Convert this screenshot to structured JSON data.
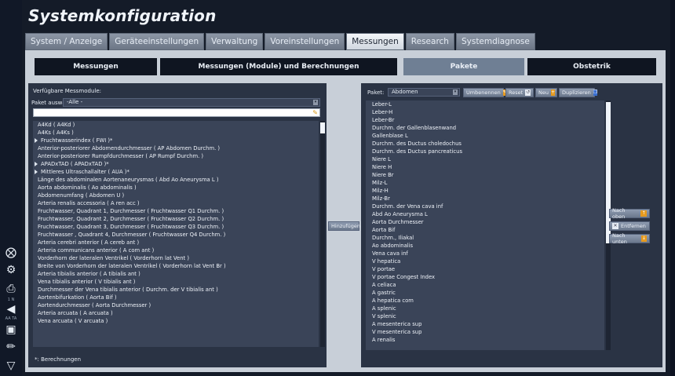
{
  "title": "Systemkonfiguration",
  "tabs": [
    {
      "label": "System / Anzeige"
    },
    {
      "label": "Geräteeinstellungen"
    },
    {
      "label": "Verwaltung"
    },
    {
      "label": "Voreinstellungen"
    },
    {
      "label": "Messungen"
    },
    {
      "label": "Research"
    },
    {
      "label": "Systemdiagnose"
    }
  ],
  "active_tab": "Messungen",
  "subtabs": [
    {
      "label": "Messungen"
    },
    {
      "label": "Messungen (Module) und Berechnungen"
    },
    {
      "label": "Pakete"
    },
    {
      "label": "Obstetrik"
    }
  ],
  "active_subtab": "Pakete",
  "left": {
    "heading": "Verfügbare Messmodule:",
    "paket_label": "Paket auswählen",
    "paket_value": "-Alle -",
    "search_value": "",
    "footer": "*: Berechnungen",
    "items": [
      {
        "text": "A4Kd ( A4Kd )",
        "expand": false
      },
      {
        "text": "A4Ks ( A4Ks )",
        "expand": false
      },
      {
        "text": "Fruchtwasserindex ( FWI )*",
        "expand": true
      },
      {
        "text": "Anterior-posteriorer Abdomendurchmesser ( AP Abdomen Durchm. )",
        "expand": false
      },
      {
        "text": "Anterior-posteriorer Rumpfdurchmesser ( AP Rumpf Durchm. )",
        "expand": false
      },
      {
        "text": "APADxTAD ( APADxTAD )*",
        "expand": true
      },
      {
        "text": "Mittleres Ultraschallalter ( AUA )*",
        "expand": true
      },
      {
        "text": "Länge des abdominalen Aortenaneurysmas ( Abd Ao Aneurysma L )",
        "expand": false
      },
      {
        "text": "Aorta abdominalis ( Ao abdominalis )",
        "expand": false
      },
      {
        "text": "Abdomenumfang ( Abdomen U )",
        "expand": false
      },
      {
        "text": "Arteria renalis accessoria ( A ren acc )",
        "expand": false
      },
      {
        "text": "Fruchtwasser, Quadrant 1, Durchmesser ( Fruchtwasser Q1 Durchm. )",
        "expand": false
      },
      {
        "text": "Fruchtwasser, Quadrant 2, Durchmesser ( Fruchtwasser Q2 Durchm. )",
        "expand": false
      },
      {
        "text": "Fruchtwasser, Quadrant 3, Durchmesser ( Fruchtwasser Q3 Durchm. )",
        "expand": false
      },
      {
        "text": "Fruchtwasser , Quadrant 4, Durchmesser ( Fruchtwasser Q4 Durchm. )",
        "expand": false
      },
      {
        "text": "Arteria cerebri anterior ( A cereb ant )",
        "expand": false
      },
      {
        "text": "Arteria communicans anterior ( A com ant )",
        "expand": false
      },
      {
        "text": "Vorderhorn der lateralen Ventrikel ( Vorderhorn lat Vent )",
        "expand": false
      },
      {
        "text": "Breite von Vorderhorn der lateralen Ventrikel ( Vorderhorn lat Vent Br )",
        "expand": false
      },
      {
        "text": "Arteria tibialis anterior ( A tibialis ant )",
        "expand": false
      },
      {
        "text": "Vena tibialis anterior ( V tibialis ant )",
        "expand": false
      },
      {
        "text": "Durchmesser der Vena tibialis anterior ( Durchm. der V tibialis ant )",
        "expand": false
      },
      {
        "text": "Aortenbifurkation ( Aorta Bif )",
        "expand": false
      },
      {
        "text": "Aortendurchmesser ( Aorta Durchmesser )",
        "expand": false
      },
      {
        "text": "Arteria arcuata ( A arcuata )",
        "expand": false
      },
      {
        "text": "Vena arcuata ( V arcuata )",
        "expand": false
      }
    ]
  },
  "add_button": "Hinzufügen",
  "right": {
    "paket_label": "Paket:",
    "paket_value": "Abdomen",
    "buttons": [
      {
        "label": "Umbenennen",
        "icon": "pencil-icon"
      },
      {
        "label": "Reset",
        "icon": "reset-icon"
      },
      {
        "label": "Neu",
        "icon": "new-icon"
      },
      {
        "label": "Duplizieren",
        "icon": "duplicate-icon"
      }
    ],
    "items": [
      "Leber-L",
      "Leber-H",
      "Leber-Br",
      "Durchm. der Gallenblasenwand",
      "Gallenblase L",
      "Durchm. des Ductus choledochus",
      "Durchm. des Ductus pancreaticus",
      "Niere L",
      "Niere H",
      "Niere Br",
      "Milz-L",
      "Milz-H",
      "Milz-Br",
      "Durchm. der Vena cava inf",
      "Abd Ao Aneurysma L",
      "Aorta Durchmesser",
      "Aorta Bif",
      "Durchm., Iliakal",
      "Ao abdominalis",
      "Vena cava inf",
      "V hepatica",
      "V portae",
      "V portae Congest Index",
      "A celiaca",
      "A gastric",
      "A hepatica com",
      "A splenic",
      "V splenic",
      "A mesenterica sup",
      "V mesenterica sup",
      "A renalis"
    ],
    "side_buttons": [
      {
        "label": "Nach oben"
      },
      {
        "label": "Entfernen"
      },
      {
        "label": "Nach unten"
      }
    ]
  },
  "leftbar": {
    "small1": "1 N",
    "small2": "AA TA"
  },
  "colors": {
    "accent": "#e69a1e",
    "panel": "#2a3344",
    "list_bg": "#3a4458"
  }
}
